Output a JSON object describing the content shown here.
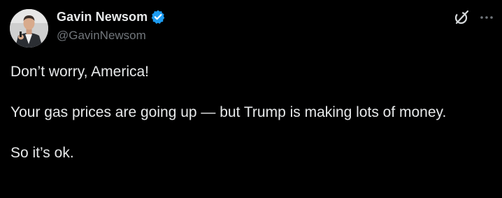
{
  "author": {
    "display_name": "Gavin Newsom",
    "handle": "@GavinNewsom",
    "verified": true,
    "avatar_icon": "avatar-photo"
  },
  "icons": {
    "grok": "grok-icon",
    "more": "more-icon",
    "verified": "verified-badge-icon"
  },
  "colors": {
    "background": "#000000",
    "text": "#e7e9ea",
    "secondary_text": "#71767b",
    "verified_blue": "#1d9bf0"
  },
  "tweet": {
    "line1": "Don’t worry, America!",
    "line2": "Your gas prices are going up — but Trump is making lots of money.",
    "line3": "So it’s ok."
  }
}
